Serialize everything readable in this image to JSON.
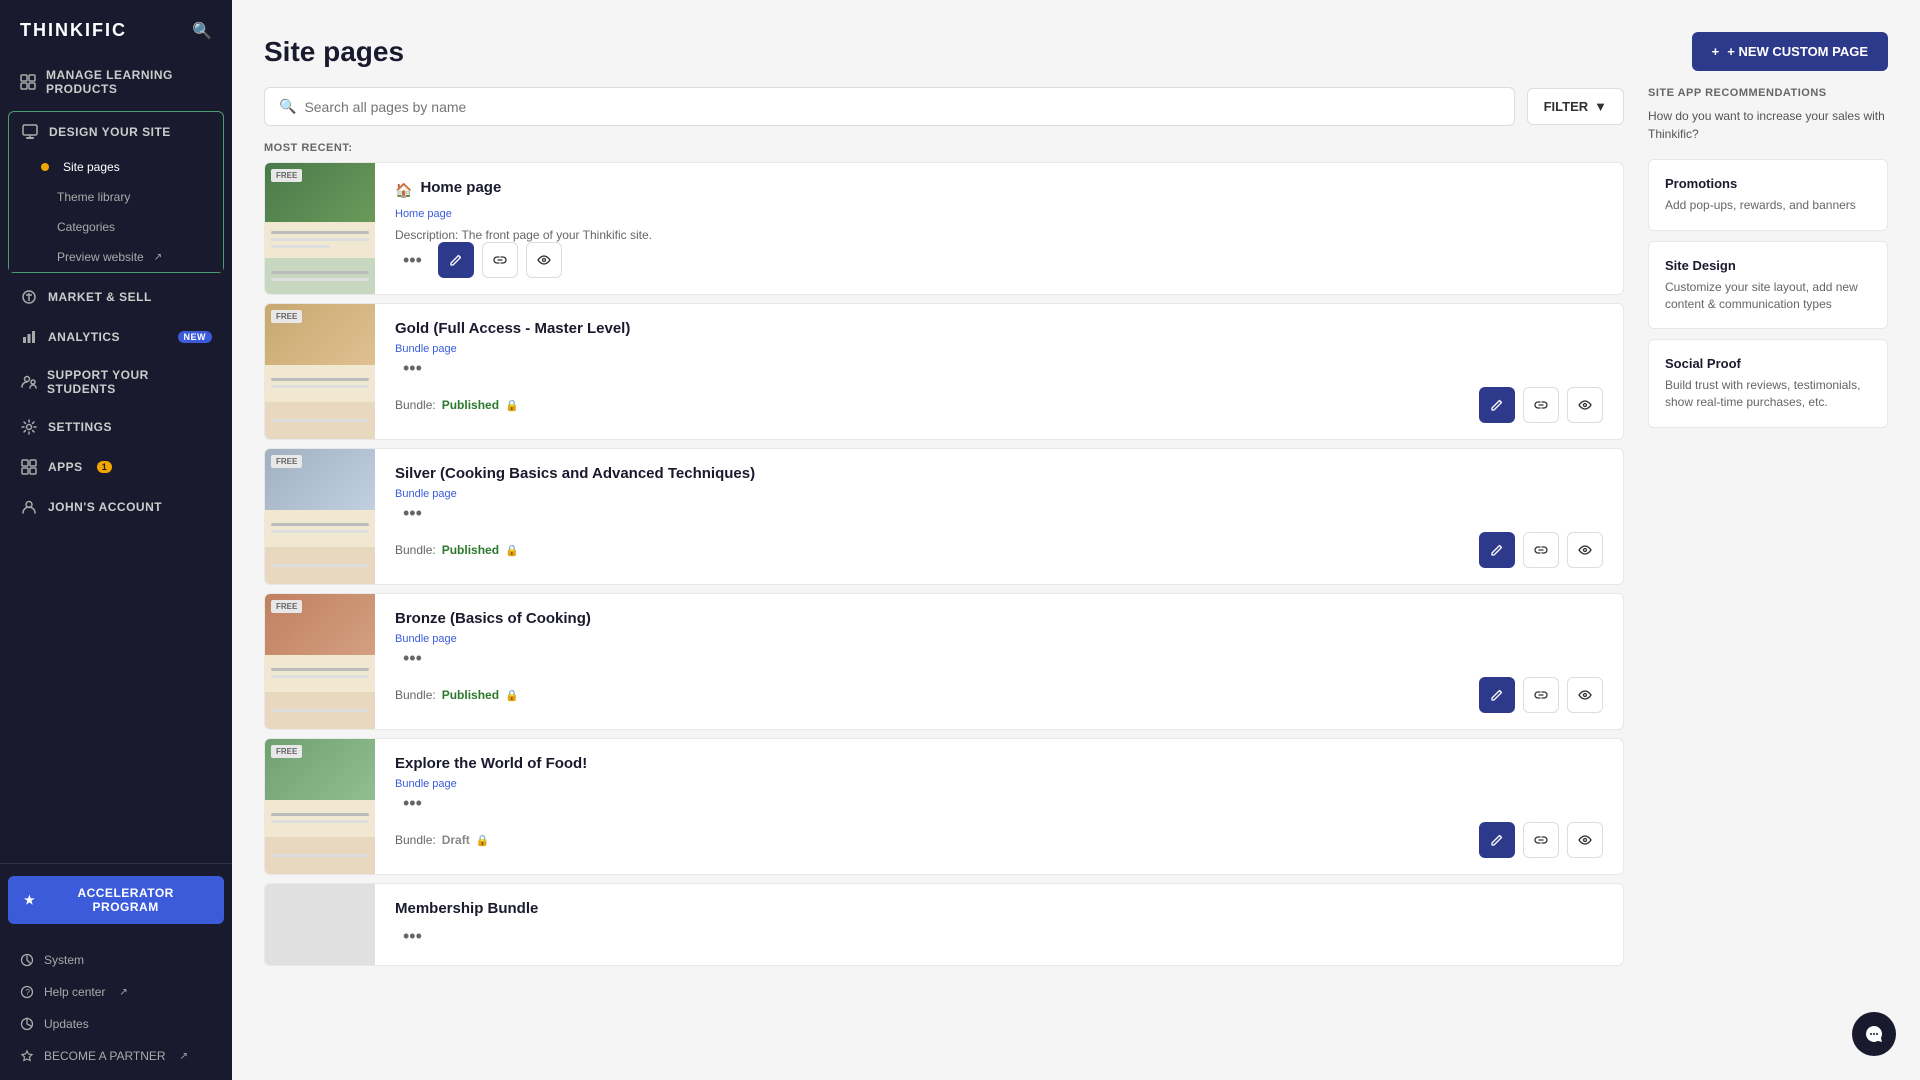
{
  "sidebar": {
    "logo": "THINKIFIC",
    "search_icon": "🔍",
    "nav_items": [
      {
        "id": "manage-learning",
        "label": "MANAGE LEARNING PRODUCTS",
        "icon": "⊞"
      },
      {
        "id": "design-site",
        "label": "DESIGN YOUR SITE",
        "icon": "◫",
        "active": true
      },
      {
        "id": "market-sell",
        "label": "MARKET & SELL",
        "icon": "◈"
      },
      {
        "id": "analytics",
        "label": "ANALYTICS",
        "icon": "📊",
        "badge": "NEW"
      },
      {
        "id": "support-students",
        "label": "SUPPORT YOUR STUDENTS",
        "icon": "👥"
      },
      {
        "id": "settings",
        "label": "SETTINGS",
        "icon": "⚙"
      },
      {
        "id": "apps",
        "label": "APPS",
        "icon": "◻",
        "badge_count": "1"
      }
    ],
    "sub_items": [
      {
        "id": "site-pages",
        "label": "Site pages",
        "active": true
      },
      {
        "id": "theme-library",
        "label": "Theme library"
      },
      {
        "id": "categories",
        "label": "Categories"
      },
      {
        "id": "preview-website",
        "label": "Preview website",
        "external": true
      }
    ],
    "account_item": {
      "label": "JOHN'S ACCOUNT",
      "icon": "👤"
    },
    "accelerator_label": "ACCELERATOR PROGRAM",
    "footer_items": [
      {
        "id": "system",
        "label": "System"
      },
      {
        "id": "help-center",
        "label": "Help center",
        "external": true
      },
      {
        "id": "updates",
        "label": "Updates"
      },
      {
        "id": "become-partner",
        "label": "BECOME A PARTNER",
        "external": true
      }
    ]
  },
  "header": {
    "title": "Site pages",
    "new_page_button": "+ NEW CUSTOM PAGE"
  },
  "search": {
    "placeholder": "Search all pages by name",
    "filter_label": "FILTER"
  },
  "pages_section": {
    "most_recent_label": "MOST RECENT:",
    "pages": [
      {
        "id": "home-page",
        "name": "Home page",
        "type": "Home page",
        "description": "Description: The front page of your Thinkific site.",
        "status": null,
        "thumbnail_type": "home"
      },
      {
        "id": "gold-bundle",
        "name": "Gold (Full Access - Master Level)",
        "type": "Bundle page",
        "status": "Bundle: Published",
        "has_lock": true,
        "thumbnail_type": "gold"
      },
      {
        "id": "silver-bundle",
        "name": "Silver (Cooking Basics and Advanced Techniques)",
        "type": "Bundle page",
        "status": "Bundle: Published",
        "has_lock": true,
        "thumbnail_type": "silver"
      },
      {
        "id": "bronze-bundle",
        "name": "Bronze (Basics of Cooking)",
        "type": "Bundle page",
        "status": "Bundle: Published",
        "has_lock": true,
        "thumbnail_type": "bronze"
      },
      {
        "id": "explore-food",
        "name": "Explore the World of Food!",
        "type": "Bundle page",
        "status": "Bundle: Draft",
        "has_lock": true,
        "thumbnail_type": "explore"
      },
      {
        "id": "membership-bundle",
        "name": "Membership Bundle",
        "type": null,
        "status": null,
        "has_lock": false,
        "thumbnail_type": "membership"
      }
    ]
  },
  "recommendations": {
    "title": "SITE APP RECOMMENDATIONS",
    "description": "How do you want to increase your sales with Thinkific?",
    "cards": [
      {
        "id": "promotions",
        "title": "Promotions",
        "description": "Add pop-ups, rewards, and banners"
      },
      {
        "id": "site-design",
        "title": "Site Design",
        "description": "Customize your site layout, add new content & communication types"
      },
      {
        "id": "social-proof",
        "title": "Social Proof",
        "description": "Build trust with reviews, testimonials, show real-time purchases, etc."
      }
    ]
  },
  "icons": {
    "search": "🔍",
    "pencil": "✏",
    "link": "🔗",
    "eye": "👁",
    "three_dot": "•••",
    "star": "★",
    "chat": "💬",
    "external_link": "↗",
    "dot_bullet": "•",
    "lock": "🔒",
    "grid": "⊞",
    "plus": "+"
  },
  "colors": {
    "accent_blue": "#2d3a8c",
    "accent_green": "#4a9d6f",
    "sidebar_bg": "#1a1a2e",
    "badge_gold": "#f0a500",
    "published_green": "#2b7a2b"
  }
}
